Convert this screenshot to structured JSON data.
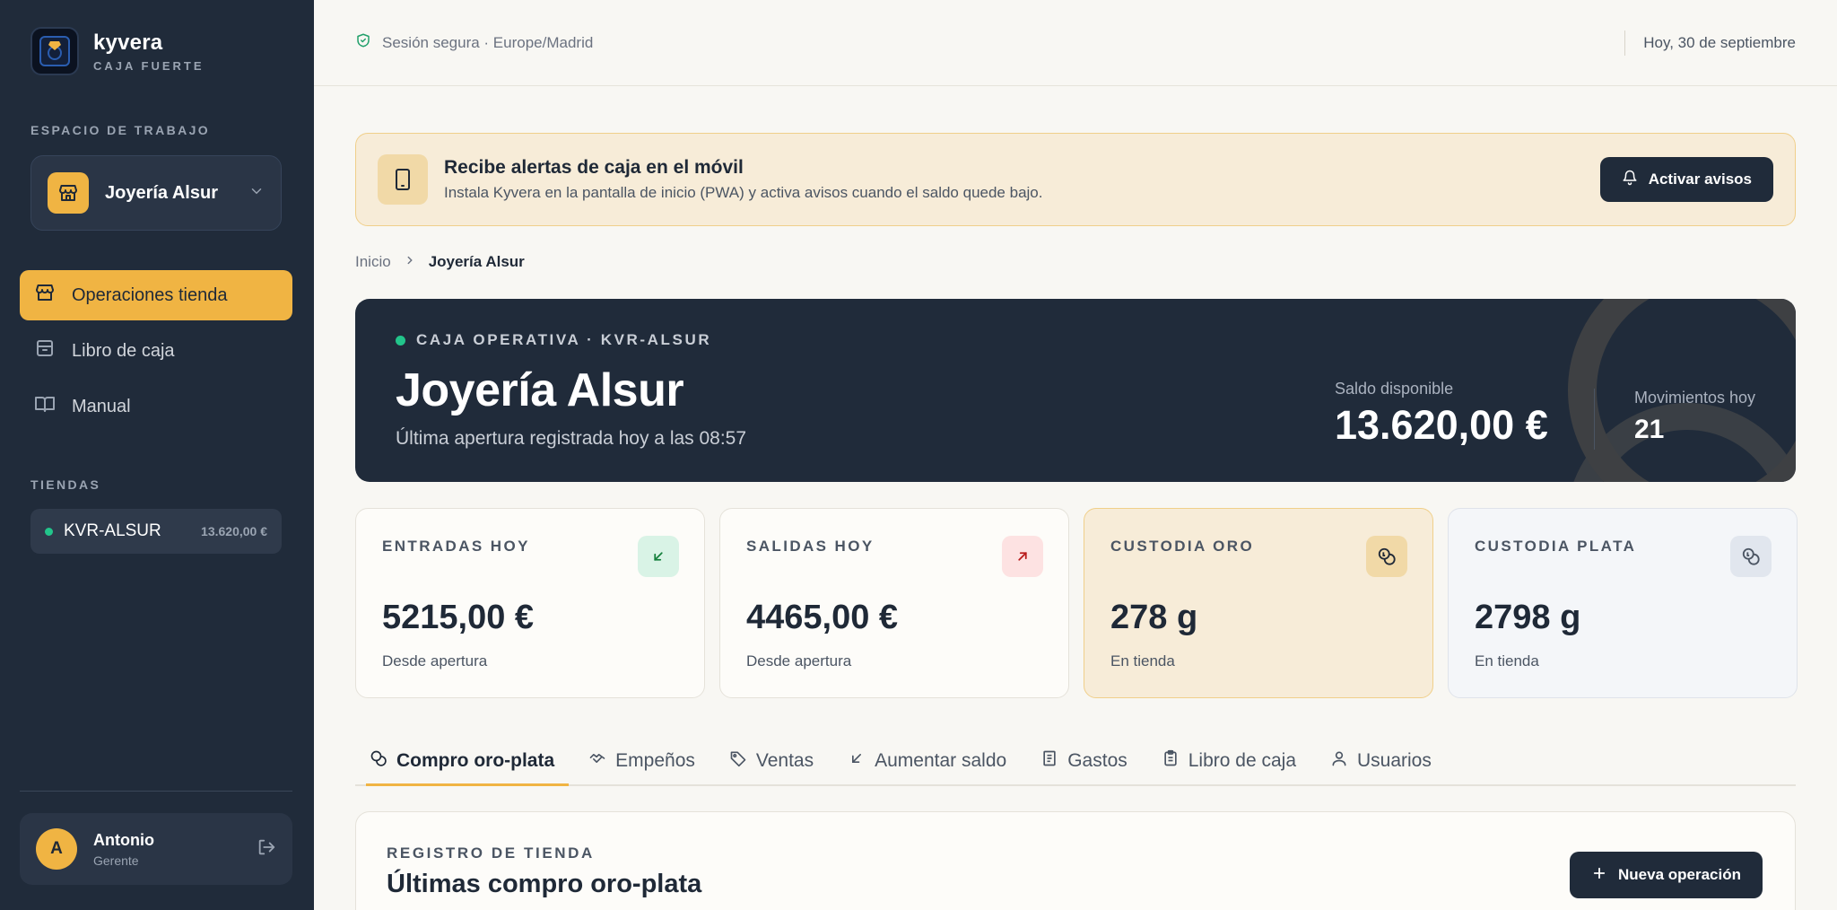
{
  "brand": {
    "name": "kyvera",
    "subtitle": "CAJA FUERTE"
  },
  "sidebar": {
    "workspace_label": "ESPACIO DE TRABAJO",
    "workspace_name": "Joyería Alsur",
    "nav": [
      {
        "label": "Operaciones tienda",
        "icon": "store-icon",
        "active": true
      },
      {
        "label": "Libro de caja",
        "icon": "archive-icon",
        "active": false
      },
      {
        "label": "Manual",
        "icon": "book-icon",
        "active": false
      }
    ],
    "stores_label": "TIENDAS",
    "stores": [
      {
        "code": "KVR-ALSUR",
        "balance": "13.620,00 €",
        "status_color": "#22c58b"
      }
    ],
    "user": {
      "initial": "A",
      "name": "Antonio",
      "role": "Gerente"
    }
  },
  "topbar": {
    "session": "Sesión segura · Europe/Madrid",
    "date": "Hoy, 30 de septiembre"
  },
  "banner": {
    "title": "Recibe alertas de caja en el móvil",
    "description": "Instala Kyvera en la pantalla de inicio (PWA) y activa avisos cuando el saldo quede bajo.",
    "button": "Activar avisos"
  },
  "breadcrumb": {
    "home": "Inicio",
    "current": "Joyería Alsur"
  },
  "hero": {
    "tag": "CAJA OPERATIVA · KVR-ALSUR",
    "title": "Joyería Alsur",
    "subtitle": "Última apertura registrada hoy a las 08:57",
    "balance_label": "Saldo disponible",
    "balance_value": "13.620,00 €",
    "movements_label": "Movimientos hoy",
    "movements_value": "21"
  },
  "stats": [
    {
      "label": "ENTRADAS HOY",
      "value": "5215,00 €",
      "foot": "Desde apertura",
      "icon": "arrow-down-left-icon"
    },
    {
      "label": "SALIDAS HOY",
      "value": "4465,00 €",
      "foot": "Desde apertura",
      "icon": "arrow-up-right-icon"
    },
    {
      "label": "CUSTODIA ORO",
      "value": "278 g",
      "foot": "En tienda",
      "icon": "coins-icon"
    },
    {
      "label": "CUSTODIA PLATA",
      "value": "2798 g",
      "foot": "En tienda",
      "icon": "coins-icon"
    }
  ],
  "tabs": [
    {
      "label": "Compro oro-plata",
      "icon": "coins-icon",
      "active": true
    },
    {
      "label": "Empeños",
      "icon": "handshake-icon",
      "active": false
    },
    {
      "label": "Ventas",
      "icon": "tag-icon",
      "active": false
    },
    {
      "label": "Aumentar saldo",
      "icon": "arrow-down-left-icon",
      "active": false
    },
    {
      "label": "Gastos",
      "icon": "receipt-icon",
      "active": false
    },
    {
      "label": "Libro de caja",
      "icon": "clipboard-icon",
      "active": false
    },
    {
      "label": "Usuarios",
      "icon": "user-icon",
      "active": false
    }
  ],
  "records": {
    "tag": "REGISTRO DE TIENDA",
    "title": "Últimas compro oro-plata",
    "button": "Nueva operación"
  },
  "colors": {
    "accent": "#f0b443",
    "sidebar_bg": "#202b3a",
    "success": "#22c58b",
    "danger_bg": "#fde2e2"
  }
}
